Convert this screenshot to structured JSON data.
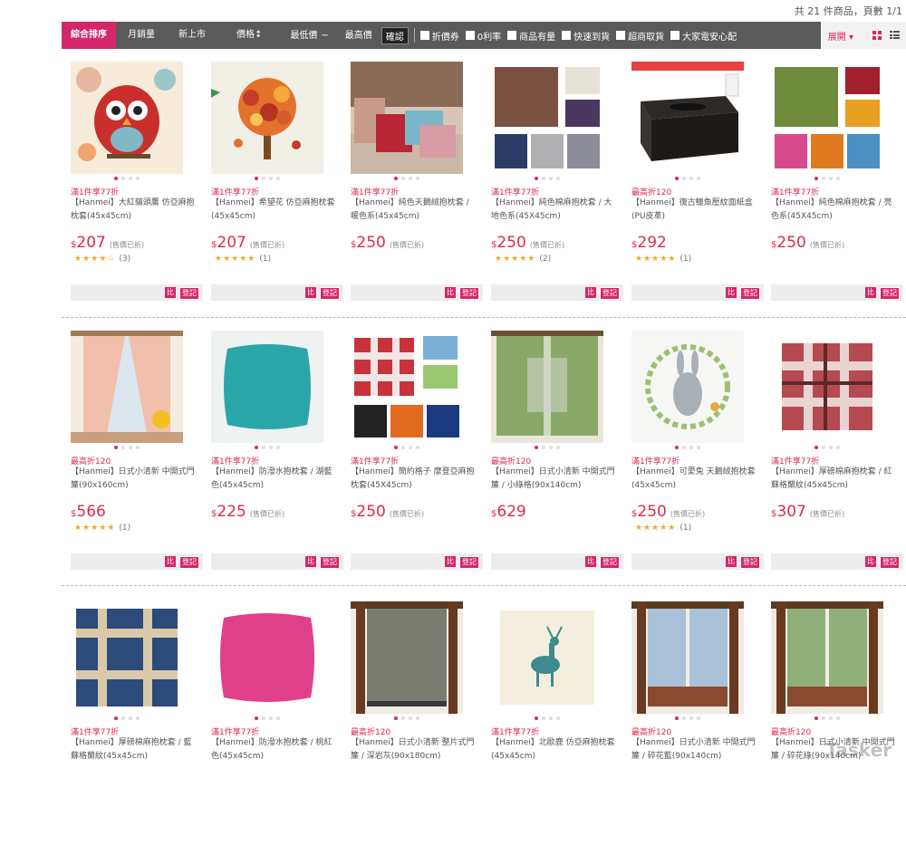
{
  "summary": "共 21 件商品，頁數 1/1",
  "filters": {
    "sort_tabs": [
      "綜合排序",
      "月銷量",
      "新上市",
      "價格↕"
    ],
    "min_placeholder": "最低價",
    "tilde": "~",
    "max_placeholder": "最高價",
    "confirm": "確認",
    "checkboxes": [
      "折價券",
      "0利率",
      "商品有量",
      "快速到貨",
      "超商取貨",
      "大家電安心配"
    ],
    "expand": "展開 ▾"
  },
  "colors": {
    "accent": "#d6266b",
    "price": "#e0294a",
    "bar": "#5a5a5a"
  },
  "action_labels": {
    "compare": "比",
    "login": "登記"
  },
  "products": [
    {
      "image": "owl-pillow",
      "promo": "滿1件享77折",
      "title": "【Hanmei】大紅貓頭鷹 仿亞麻抱枕套(45x45cm)",
      "currency": "$",
      "price": "207",
      "note": "(售價已折)",
      "stars": "★★★★☆",
      "reviews": "(3)"
    },
    {
      "image": "flower-tree-pillow",
      "promo": "滿1件享77折",
      "title": "【Hanmei】希望花 仿亞麻抱枕套(45x45cm)",
      "currency": "$",
      "price": "207",
      "note": "(售價已折)",
      "stars": "★★★★★",
      "reviews": "(1)"
    },
    {
      "image": "velvet-pillows",
      "promo": "滿1件享77折",
      "title": "【Hanmei】純色天鵝絨抱枕套 / 暖色系(45x45cm)",
      "currency": "$",
      "price": "250",
      "note": "(售價已折)",
      "stars": "",
      "reviews": ""
    },
    {
      "image": "linen-earth-pillows",
      "promo": "滿1件享77折",
      "title": "【Hanmei】純色棉麻抱枕套 / 大地色系(45X45cm)",
      "currency": "$",
      "price": "250",
      "note": "(售價已折)",
      "stars": "★★★★★",
      "reviews": "(2)"
    },
    {
      "image": "tissue-box",
      "promo": "最高折120",
      "title": "【Hanmei】復古鱷魚壓紋面紙盒(PU皮革)",
      "currency": "$",
      "price": "292",
      "note": "",
      "stars": "★★★★★",
      "reviews": "(1)"
    },
    {
      "image": "linen-bright-pillows",
      "promo": "滿1件享77折",
      "title": "【Hanmei】純色棉麻抱枕套 / 亮色系(45X45cm)",
      "currency": "$",
      "price": "250",
      "note": "(售價已折)",
      "stars": "",
      "reviews": ""
    },
    {
      "image": "window-curtain",
      "promo": "最高折120",
      "title": "【Hanmei】日式小清新 中開式門簾(90x160cm)",
      "currency": "$",
      "price": "566",
      "note": "",
      "stars": "★★★★★",
      "reviews": "(1)"
    },
    {
      "image": "teal-pillow",
      "promo": "滿1件享77折",
      "title": "【Hanmei】防潑水抱枕套 / 湖藍色(45x45cm)",
      "currency": "$",
      "price": "225",
      "note": "(售價已折)",
      "stars": "",
      "reviews": ""
    },
    {
      "image": "check-pillows",
      "promo": "滿1件享77折",
      "title": "【Hanmei】簡約格子 摩登亞麻抱枕套(45X45cm)",
      "currency": "$",
      "price": "250",
      "note": "(售價已折)",
      "stars": "",
      "reviews": ""
    },
    {
      "image": "green-curtain",
      "promo": "最高折120",
      "title": "【Hanmei】日式小清新 中開式門簾 / 小綠格(90x140cm)",
      "currency": "$",
      "price": "629",
      "note": "",
      "stars": "",
      "reviews": ""
    },
    {
      "image": "rabbit-pillow",
      "promo": "滿1件享77折",
      "title": "【Hanmei】可愛兔 天鵝絨抱枕套(45x45cm)",
      "currency": "$",
      "price": "250",
      "note": "(售價已折)",
      "stars": "★★★★★",
      "reviews": "(1)"
    },
    {
      "image": "red-plaid-pillow",
      "promo": "滿1件享77折",
      "title": "【Hanmei】厚磅棉麻抱枕套 / 紅蘇格蘭紋(45x45cm)",
      "currency": "$",
      "price": "307",
      "note": "(售價已折)",
      "stars": "",
      "reviews": ""
    },
    {
      "image": "blue-plaid-pillow",
      "promo": "滿1件享77折",
      "title": "【Hanmei】厚磅棉麻抱枕套 / 藍蘇格蘭紋(45x45cm)",
      "currency": "",
      "price": "",
      "note": "",
      "stars": "",
      "reviews": ""
    },
    {
      "image": "pink-pillow",
      "promo": "滿1件享77折",
      "title": "【Hanmei】防潑水抱枕套 / 桃紅色(45x45cm)",
      "currency": "",
      "price": "",
      "note": "",
      "stars": "",
      "reviews": ""
    },
    {
      "image": "gray-door-curtain",
      "promo": "最高折120",
      "title": "【Hanmei】日式小清新 整片式門簾 / 深岩灰(90x180cm)",
      "currency": "",
      "price": "",
      "note": "",
      "stars": "",
      "reviews": ""
    },
    {
      "image": "deer-pillow",
      "promo": "滿1件享77折",
      "title": "【Hanmei】北歐鹿 仿亞麻抱枕套(45x45cm)",
      "currency": "",
      "price": "",
      "note": "",
      "stars": "",
      "reviews": ""
    },
    {
      "image": "blue-floral-curtain",
      "promo": "最高折120",
      "title": "【Hanmei】日式小清新 中開式門簾 / 碎花藍(90x140cm)",
      "currency": "",
      "price": "",
      "note": "",
      "stars": "",
      "reviews": ""
    },
    {
      "image": "green-floral-curtain",
      "promo": "最高折120",
      "title": "【Hanmei】日式小清新 中開式門簾 / 碎花綠(90x140cm)",
      "currency": "",
      "price": "",
      "note": "",
      "stars": "",
      "reviews": ""
    }
  ],
  "watermark": "Tasker"
}
